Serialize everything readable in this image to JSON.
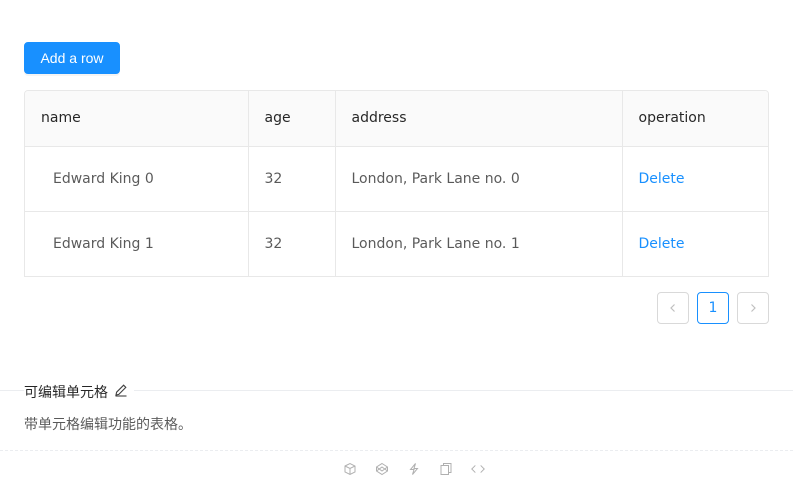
{
  "toolbar": {
    "add_row_label": "Add a row"
  },
  "table": {
    "columns": [
      "name",
      "age",
      "address",
      "operation"
    ],
    "rows": [
      {
        "name": "Edward King 0",
        "age": "32",
        "address": "London, Park Lane no. 0",
        "operation": "Delete"
      },
      {
        "name": "Edward King 1",
        "age": "32",
        "address": "London, Park Lane no. 1",
        "operation": "Delete"
      }
    ]
  },
  "pagination": {
    "current_page": "1"
  },
  "demo": {
    "title": "可编辑单元格",
    "description": "带单元格编辑功能的表格。"
  },
  "icons": {
    "edit": "edit-icon",
    "prev": "chevron-left-icon",
    "next": "chevron-right-icon",
    "codesandbox": "codesandbox-icon",
    "codepen": "codepen-icon",
    "riddle": "riddle-icon",
    "copy": "copy-icon",
    "code": "code-icon"
  },
  "colors": {
    "primary": "#1890ff",
    "border": "#e8e8e8",
    "header_bg": "#fafafa"
  }
}
